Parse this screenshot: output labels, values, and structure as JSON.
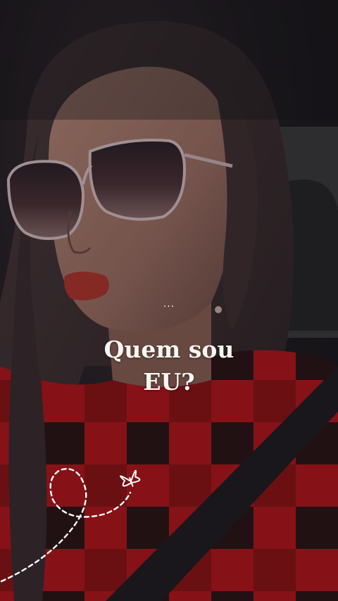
{
  "story": {
    "ellipsis": "...",
    "title_line1": "Quem sou",
    "title_line2": "EU?"
  },
  "decorations": {
    "icon": "butterfly-icon",
    "path_style": "dashed-white-loop"
  },
  "colors": {
    "text": "#fbf6f2",
    "shirt_red": "#b5161c",
    "lips": "#b3352f",
    "background": "#1b1a1e"
  }
}
